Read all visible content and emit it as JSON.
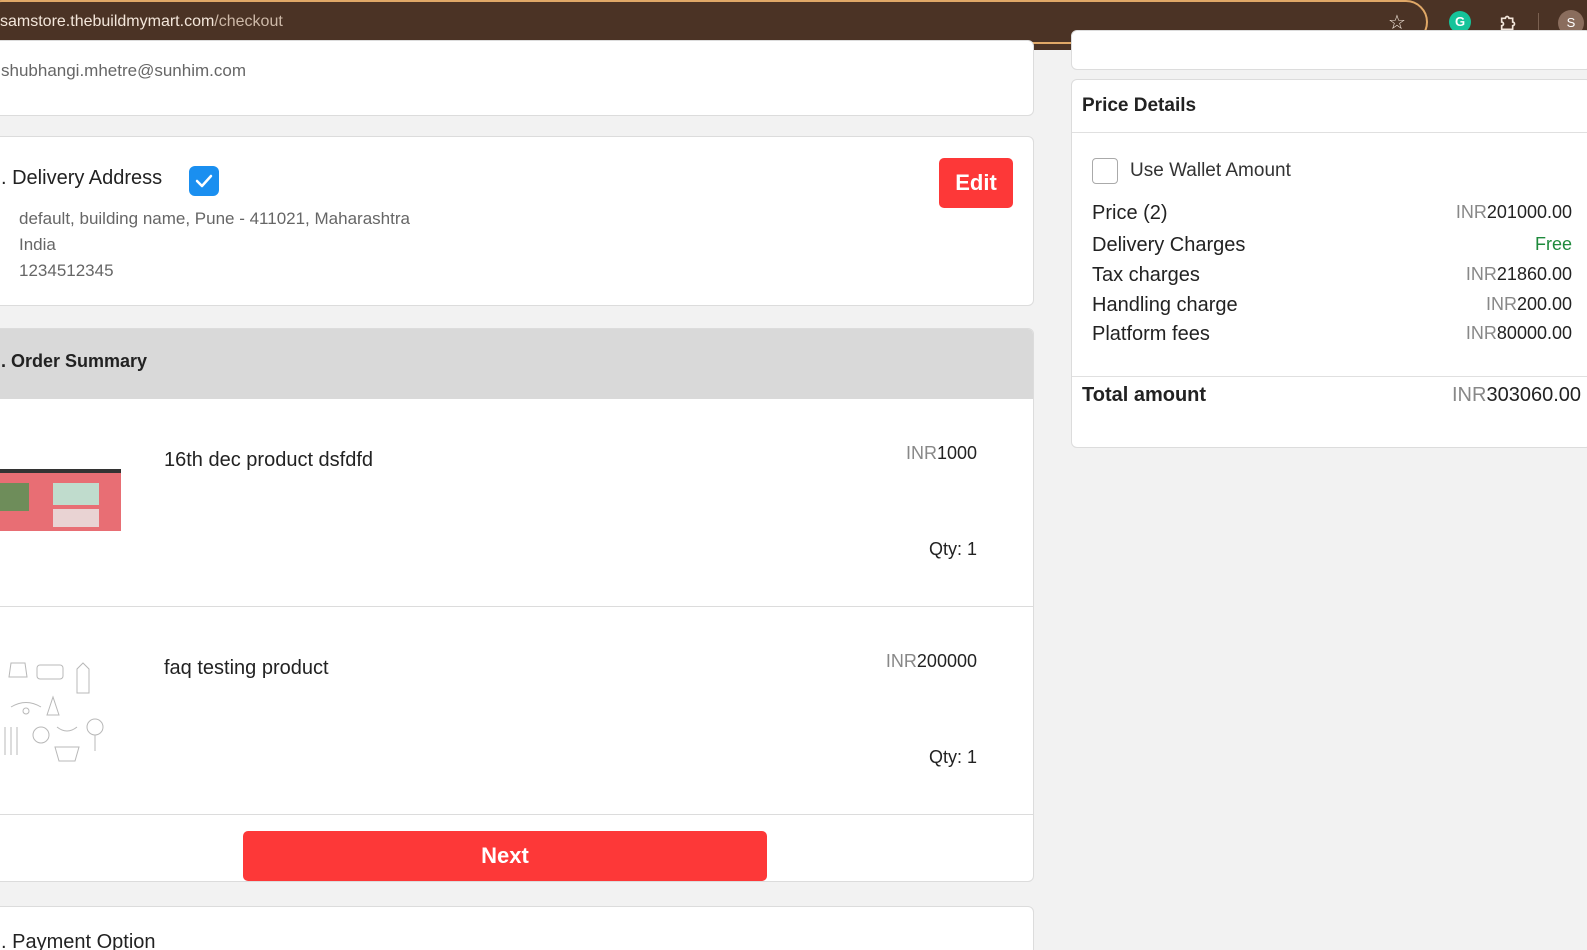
{
  "browser": {
    "url_host": "samstore.thebuildmymart.com",
    "url_path": "/checkout",
    "profile_initial": "S",
    "grammarly_letter": "G"
  },
  "login": {
    "email": "shubhangi.mhetre@sunhim.com"
  },
  "address": {
    "title": ". Delivery Address",
    "line1": "default, building name, Pune - 411021, Maharashtra",
    "line2": "India",
    "phone": "1234512345",
    "edit_label": "Edit"
  },
  "order": {
    "title": ". Order Summary",
    "items": [
      {
        "name": "16th dec product dsfdfd",
        "currency": "INR",
        "price": "1000",
        "qty": "Qty: 1"
      },
      {
        "name": "faq testing product",
        "currency": "INR",
        "price": "200000",
        "qty": "Qty: 1"
      }
    ],
    "next_label": "Next"
  },
  "payment": {
    "title": ". Payment Option"
  },
  "price_details": {
    "title": "Price Details",
    "wallet_label": "Use Wallet Amount",
    "rows": [
      {
        "label": "Price (2)",
        "currency": "INR",
        "value": "201000.00"
      },
      {
        "label": "Delivery Charges",
        "currency": "",
        "value": "Free"
      },
      {
        "label": "Tax charges",
        "currency": "INR",
        "value": "21860.00"
      },
      {
        "label": "Handling charge",
        "currency": "INR",
        "value": "200.00"
      },
      {
        "label": "Platform fees",
        "currency": "INR",
        "value": "80000.00"
      }
    ],
    "total_label": "Total amount",
    "total_currency": "INR",
    "total_value": "303060.00"
  },
  "colors": {
    "accent_red": "#fd3838",
    "check_blue": "#1a8ff0",
    "free_green": "#1e8a3c",
    "browser_bar": "#4b3325"
  }
}
